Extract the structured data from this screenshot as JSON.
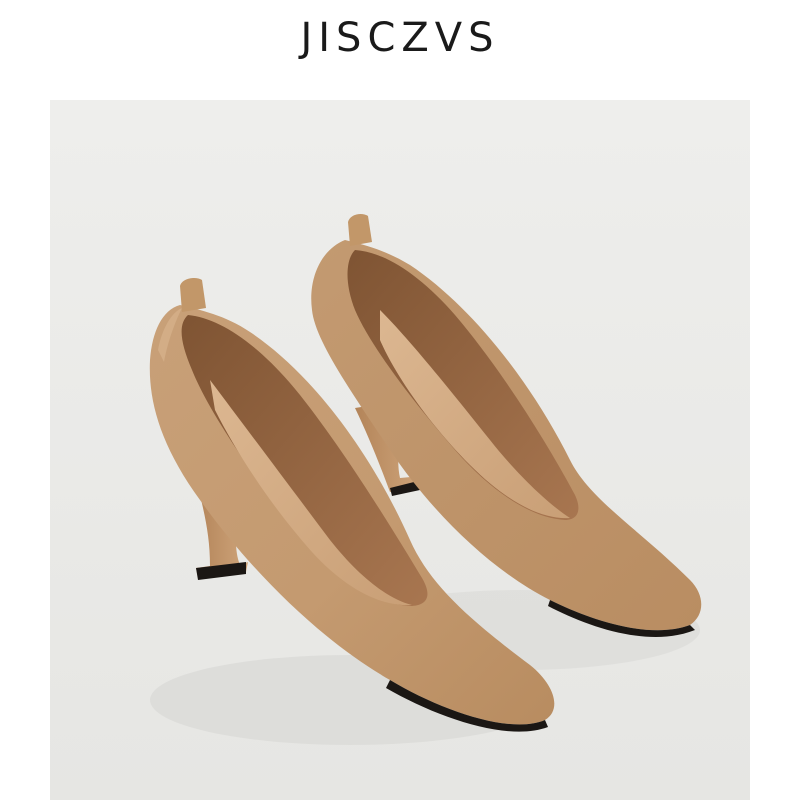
{
  "brand": {
    "name": "JISCZVS"
  },
  "photo": {
    "subject-icon": "pair-of-tan-leather-pumps-icon",
    "colors": {
      "background": "#ededeb",
      "leather": "#c9a27a",
      "leather_shadow": "#a97e55",
      "lining": "#9a6a45",
      "insole": "#d7b08a",
      "sole": "#1b1714"
    }
  }
}
